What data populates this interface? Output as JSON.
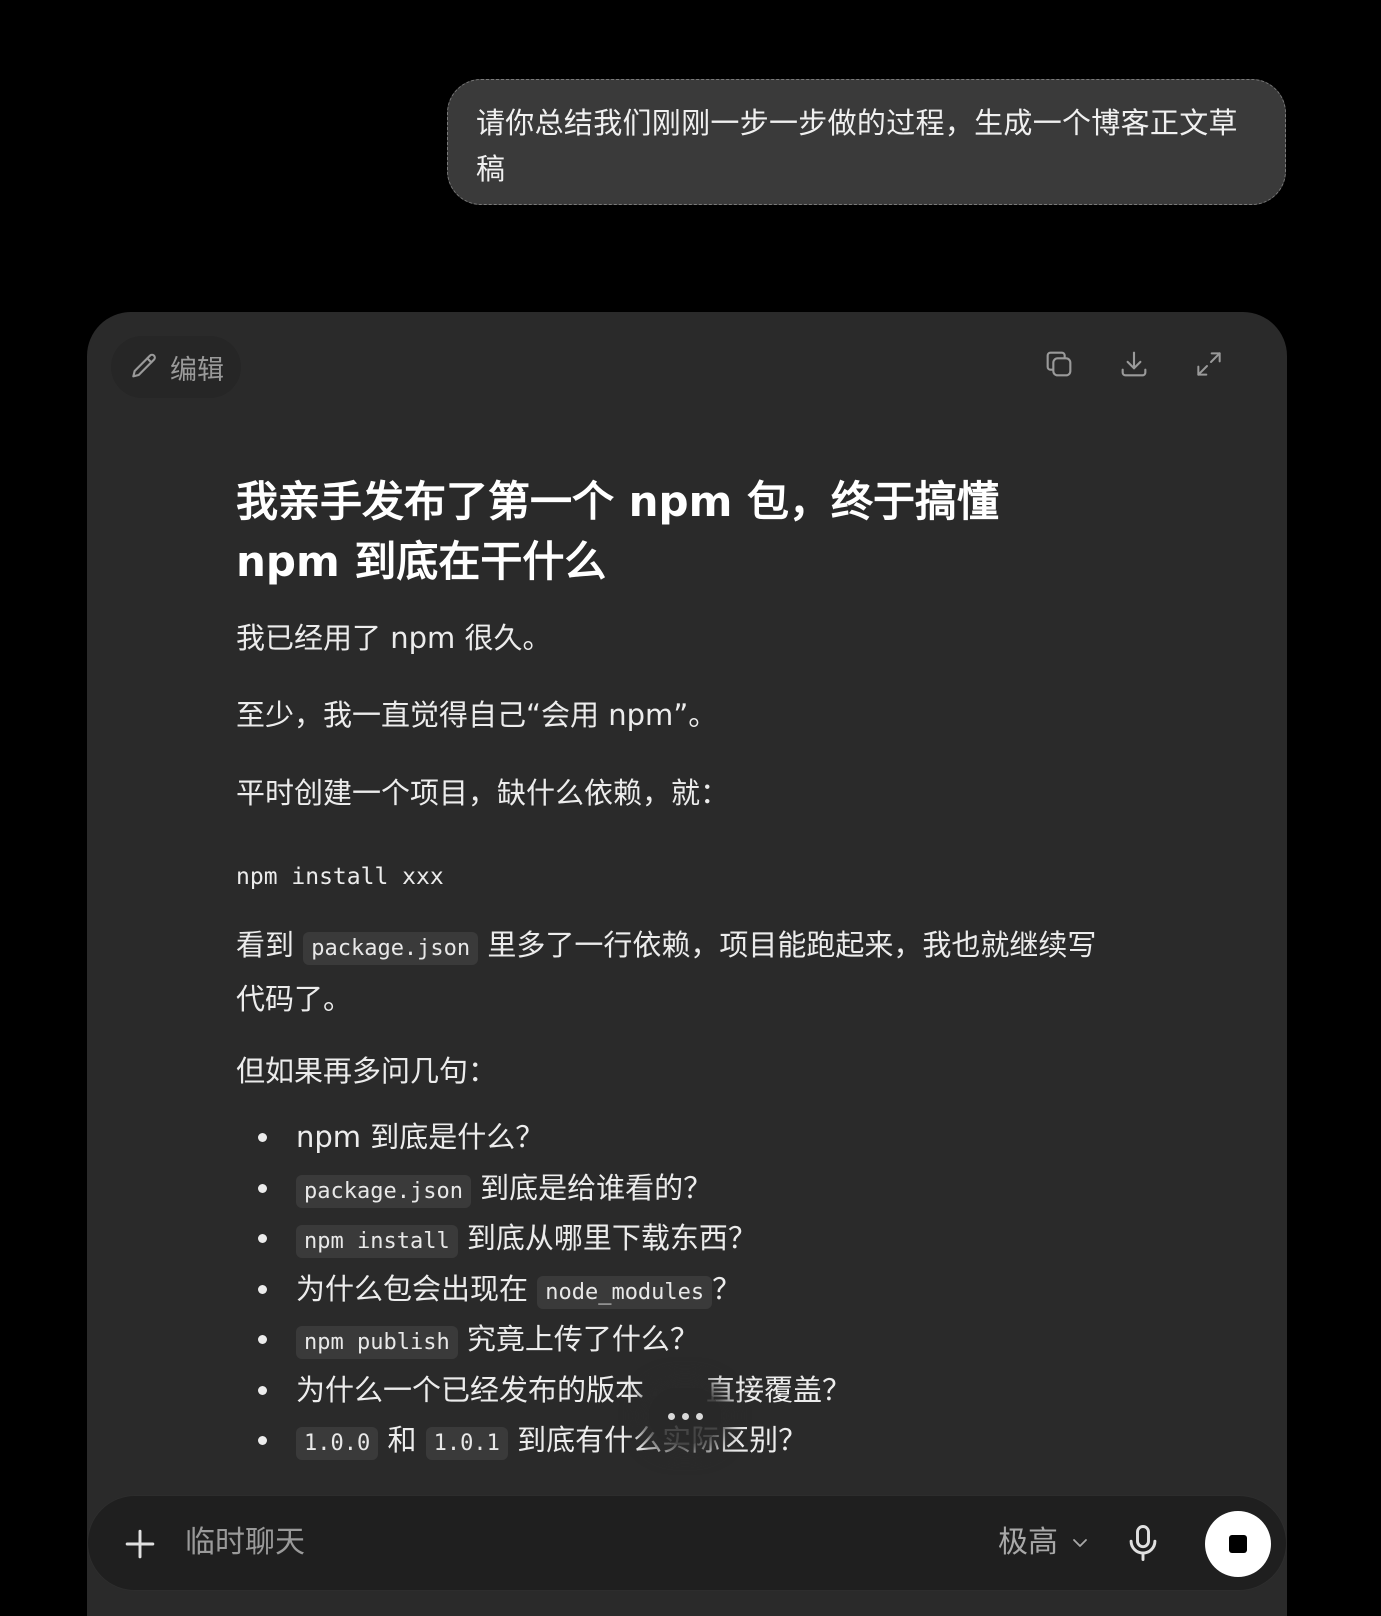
{
  "user_message": {
    "line1": "请你总结我们刚刚一步一步做的过程，生成一个博客正文草",
    "line2": "稿"
  },
  "canvas": {
    "edit_label": "编辑",
    "title_line1": "我亲手发布了第一个 npm 包，终于搞懂",
    "title_line2": "npm 到底在干什么",
    "p1": "我已经用了 npm 很久。",
    "p2": "至少，我一直觉得自己“会用 npm”。",
    "p3": "平时创建一个项目，缺什么依赖，就：",
    "code": "npm install xxx",
    "p4_pre": "看到 ",
    "p4_code": "package.json",
    "p4_post": " 里多了一行依赖，项目能跑起来，我也就继续写",
    "p4_line2": "代码了。",
    "p5": "但如果再多问几句：",
    "list": {
      "i1": "npm 到底是什么？",
      "i2_code": "package.json",
      "i2_text": " 到底是给谁看的？",
      "i3_code": "npm install",
      "i3_text": " 到底从哪里下载东西？",
      "i4_text": "为什么包会出现在 ",
      "i4_code": "node_modules",
      "i4_post": "？",
      "i5_code": "npm publish",
      "i5_text": " 究竟上传了什么？",
      "i6_text_a": "为什么一个已经发布的版本",
      "i6_text_b": "直接覆盖？",
      "i7_code_a": "1.0.0",
      "i7_mid": " 和 ",
      "i7_code_b": "1.0.1",
      "i7_text": " 到底有什么实际区别？"
    }
  },
  "composer": {
    "placeholder": "临时聊天",
    "model_label": "极高"
  },
  "icons": [
    "pencil-icon",
    "copy-icon",
    "download-icon",
    "expand-icon",
    "plus-icon",
    "chevron-down-icon",
    "microphone-icon",
    "stop-icon"
  ]
}
